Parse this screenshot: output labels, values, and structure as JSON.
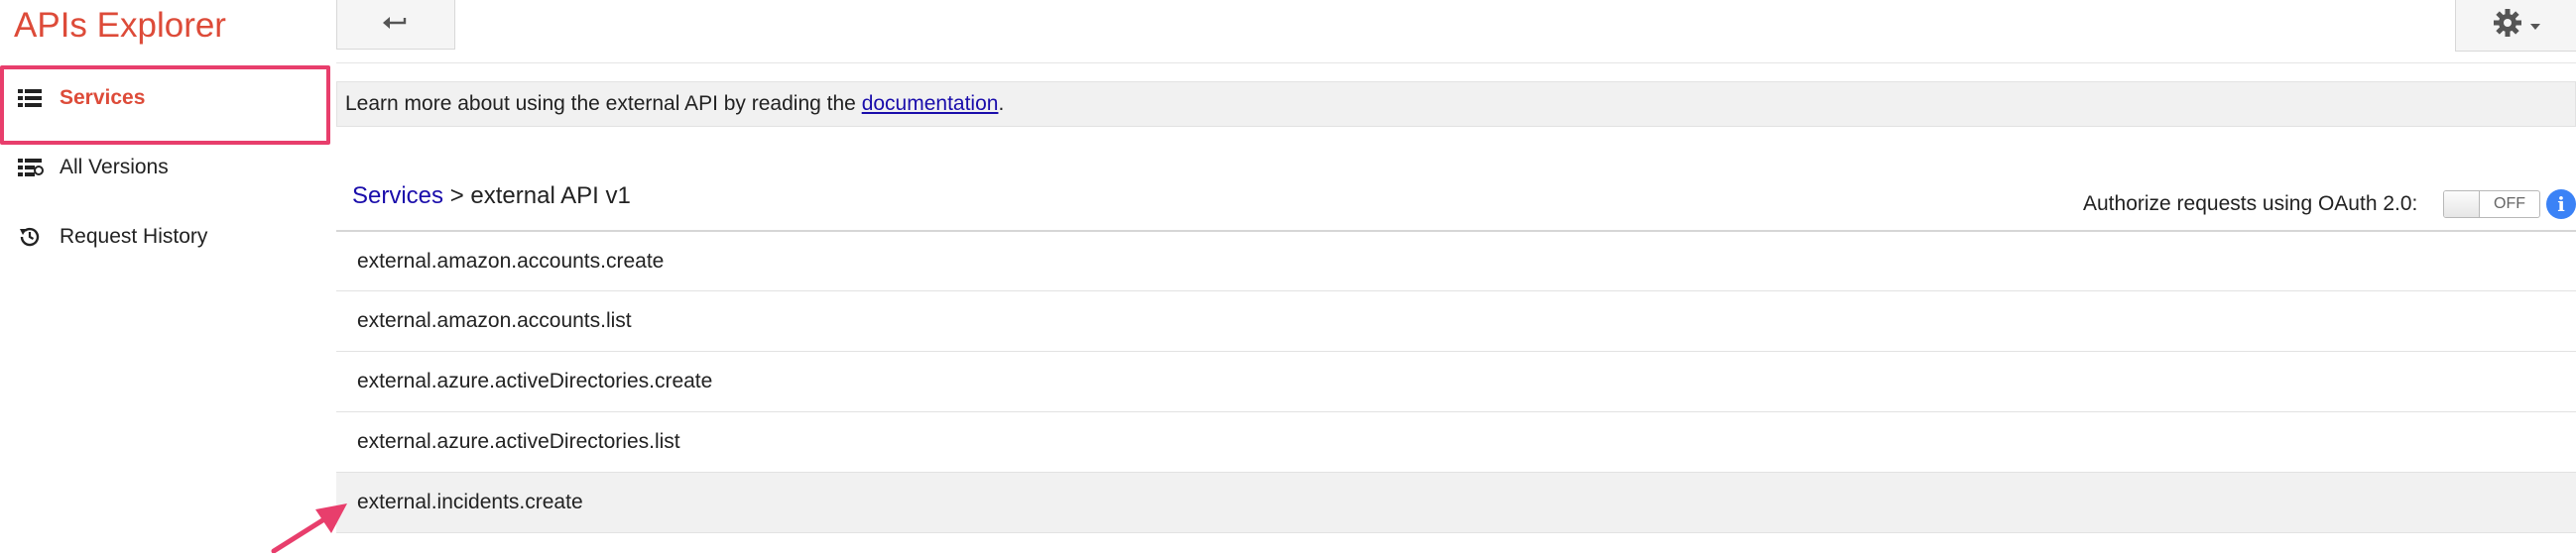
{
  "app": {
    "title": "APIs Explorer"
  },
  "sidebar": {
    "items": [
      {
        "label": "Services",
        "icon": "list-icon"
      },
      {
        "label": "All Versions",
        "icon": "versions-list-icon"
      },
      {
        "label": "Request History",
        "icon": "history-icon"
      }
    ]
  },
  "toolbar": {
    "back_icon": "back-arrow-icon",
    "settings_icon": "gear-icon"
  },
  "info_bar": {
    "text": "Learn more about using the external API by reading the ",
    "link": "documentation",
    "suffix": "."
  },
  "breadcrumb": {
    "root": "Services",
    "separator": " > ",
    "current": "external API v1"
  },
  "oauth": {
    "label": "Authorize requests using OAuth 2.0:",
    "toggle_state": "OFF",
    "info_icon": "info-icon"
  },
  "methods": [
    "external.amazon.accounts.create",
    "external.amazon.accounts.list",
    "external.azure.activeDirectories.create",
    "external.azure.activeDirectories.list",
    "external.incidents.create"
  ],
  "colors": {
    "brand": "#dd4b39",
    "highlight_outline": "#e83e6c",
    "link": "#1a0dab",
    "info": "#3b82f6"
  }
}
